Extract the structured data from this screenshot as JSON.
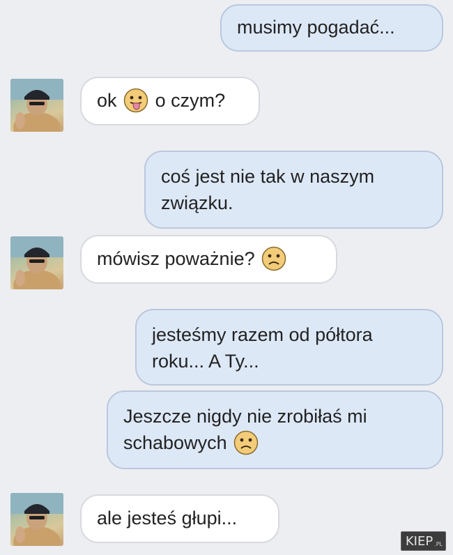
{
  "messages": [
    {
      "sender": "me",
      "text": "musimy pogadać..."
    },
    {
      "sender": "them",
      "text_before": "ok",
      "emoji": "tongue-out-emoji",
      "text_after": "o czym?"
    },
    {
      "sender": "me",
      "lines": [
        "coś jest nie tak w naszym",
        "związku."
      ]
    },
    {
      "sender": "them",
      "text_before": "mówisz poważnie?",
      "emoji": "sad-emoji"
    },
    {
      "sender": "me",
      "lines": [
        "jesteśmy razem od półtora",
        "roku... A Ty..."
      ]
    },
    {
      "sender": "me",
      "lines": [
        "Jeszcze nigdy nie zrobiłaś mi",
        "schabowych"
      ],
      "emoji": "sad-emoji"
    },
    {
      "sender": "them",
      "text": "ale jesteś głupi..."
    }
  ],
  "watermark": {
    "text": "KIEP",
    "tld": ".PL"
  },
  "colors": {
    "background": "#edeef2",
    "sent_bubble": "#dde8f7",
    "received_bubble": "#ffffff",
    "emoji_face": "#f2cc78"
  }
}
